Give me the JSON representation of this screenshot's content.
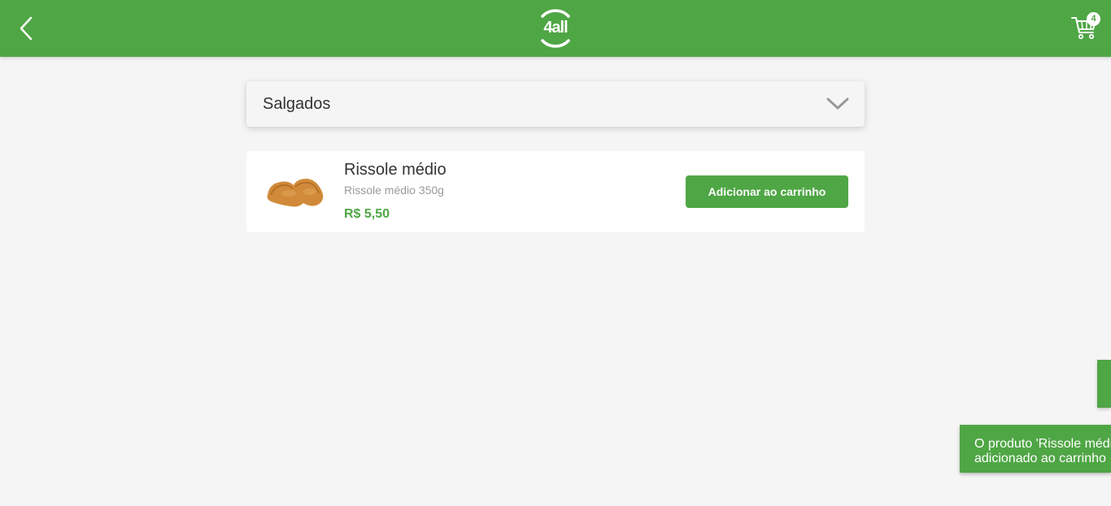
{
  "header": {
    "logo_text": "4all",
    "cart_count": "4",
    "brand_color": "#4fa645",
    "icons": {
      "back": "chevron-left-icon",
      "cart": "shopping-cart-icon"
    }
  },
  "category": {
    "label": "Salgados",
    "icon": "chevron-down-icon"
  },
  "products": [
    {
      "name": "Rissole médio",
      "description": "Rissole médio 350g",
      "price": "R$ 5,50",
      "button_label": "Adicionar ao carrinho"
    }
  ],
  "toast": {
    "line1": "O produto 'Rissole médio'",
    "line2": "adicionado ao carrinho"
  }
}
